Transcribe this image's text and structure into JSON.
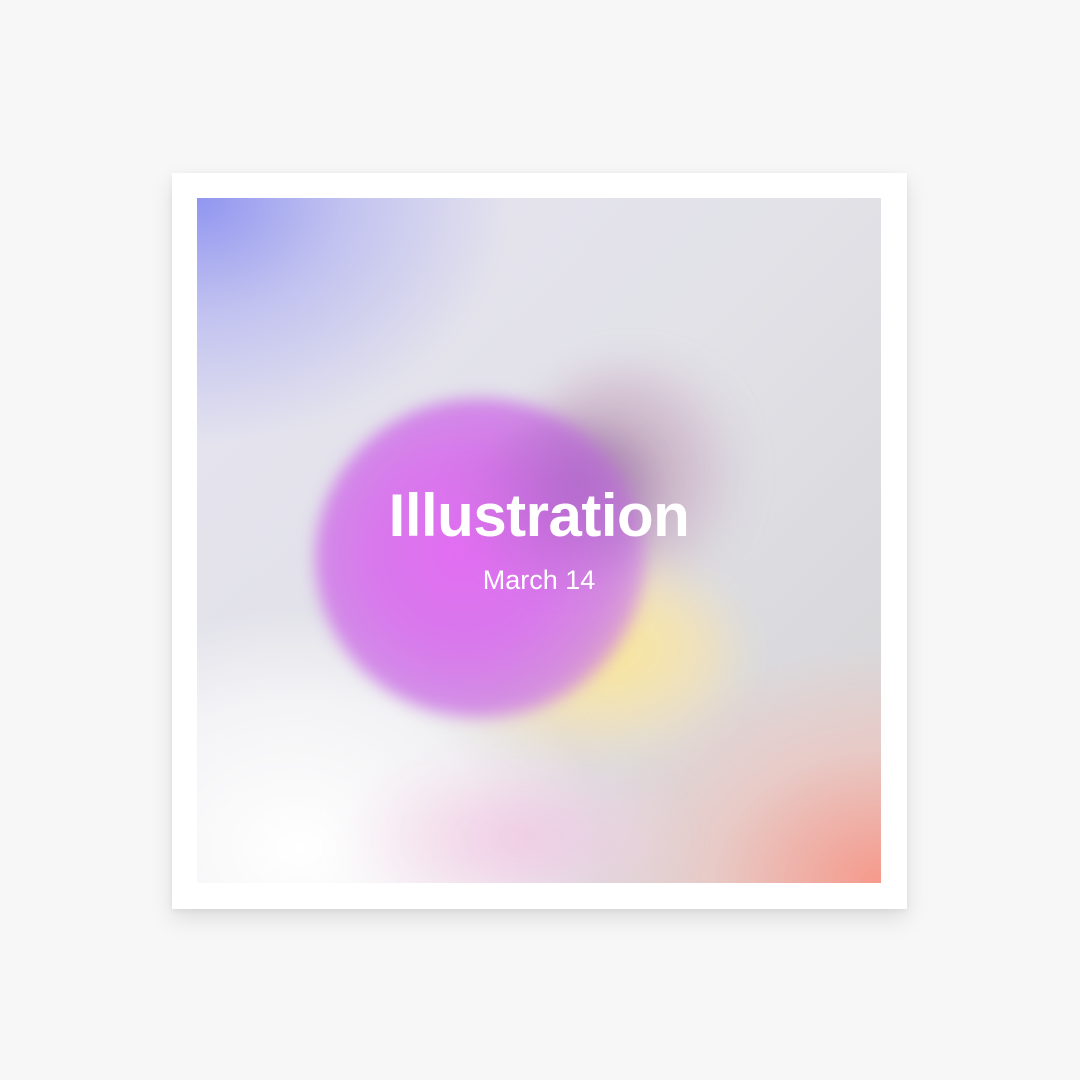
{
  "poster": {
    "title": "Illustration",
    "date": "March 14"
  },
  "colors": {
    "page_background": "#f7f7f7",
    "frame": "#ffffff",
    "blob_magenta": "#e26ef2",
    "corner_blue": "#8c91f0",
    "corner_coral": "#f89687",
    "blob_yellow": "#fce88c",
    "text": "#ffffff"
  }
}
